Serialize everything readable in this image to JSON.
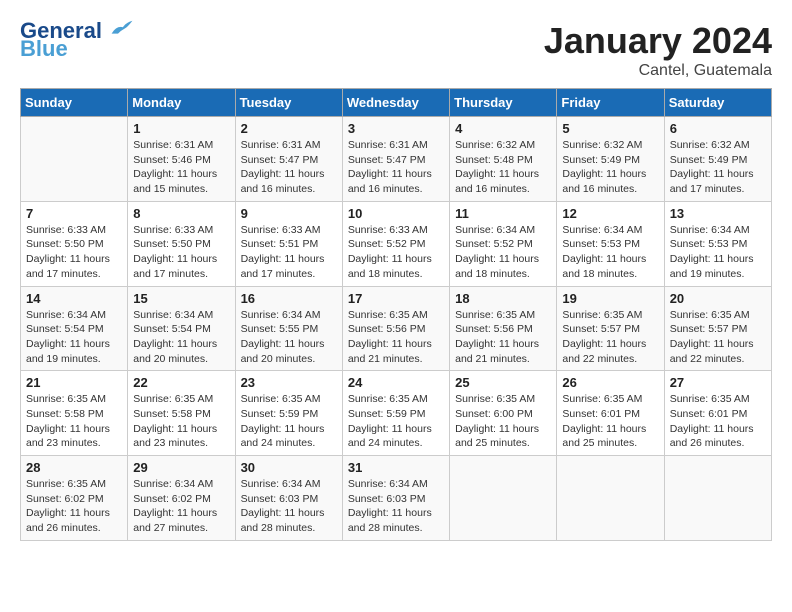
{
  "header": {
    "logo_line1": "General",
    "logo_line2": "Blue",
    "month_title": "January 2024",
    "subtitle": "Cantel, Guatemala"
  },
  "weekdays": [
    "Sunday",
    "Monday",
    "Tuesday",
    "Wednesday",
    "Thursday",
    "Friday",
    "Saturday"
  ],
  "weeks": [
    [
      {
        "day": "",
        "info": ""
      },
      {
        "day": "1",
        "info": "Sunrise: 6:31 AM\nSunset: 5:46 PM\nDaylight: 11 hours\nand 15 minutes."
      },
      {
        "day": "2",
        "info": "Sunrise: 6:31 AM\nSunset: 5:47 PM\nDaylight: 11 hours\nand 16 minutes."
      },
      {
        "day": "3",
        "info": "Sunrise: 6:31 AM\nSunset: 5:47 PM\nDaylight: 11 hours\nand 16 minutes."
      },
      {
        "day": "4",
        "info": "Sunrise: 6:32 AM\nSunset: 5:48 PM\nDaylight: 11 hours\nand 16 minutes."
      },
      {
        "day": "5",
        "info": "Sunrise: 6:32 AM\nSunset: 5:49 PM\nDaylight: 11 hours\nand 16 minutes."
      },
      {
        "day": "6",
        "info": "Sunrise: 6:32 AM\nSunset: 5:49 PM\nDaylight: 11 hours\nand 17 minutes."
      }
    ],
    [
      {
        "day": "7",
        "info": "Sunrise: 6:33 AM\nSunset: 5:50 PM\nDaylight: 11 hours\nand 17 minutes."
      },
      {
        "day": "8",
        "info": "Sunrise: 6:33 AM\nSunset: 5:50 PM\nDaylight: 11 hours\nand 17 minutes."
      },
      {
        "day": "9",
        "info": "Sunrise: 6:33 AM\nSunset: 5:51 PM\nDaylight: 11 hours\nand 17 minutes."
      },
      {
        "day": "10",
        "info": "Sunrise: 6:33 AM\nSunset: 5:52 PM\nDaylight: 11 hours\nand 18 minutes."
      },
      {
        "day": "11",
        "info": "Sunrise: 6:34 AM\nSunset: 5:52 PM\nDaylight: 11 hours\nand 18 minutes."
      },
      {
        "day": "12",
        "info": "Sunrise: 6:34 AM\nSunset: 5:53 PM\nDaylight: 11 hours\nand 18 minutes."
      },
      {
        "day": "13",
        "info": "Sunrise: 6:34 AM\nSunset: 5:53 PM\nDaylight: 11 hours\nand 19 minutes."
      }
    ],
    [
      {
        "day": "14",
        "info": "Sunrise: 6:34 AM\nSunset: 5:54 PM\nDaylight: 11 hours\nand 19 minutes."
      },
      {
        "day": "15",
        "info": "Sunrise: 6:34 AM\nSunset: 5:54 PM\nDaylight: 11 hours\nand 20 minutes."
      },
      {
        "day": "16",
        "info": "Sunrise: 6:34 AM\nSunset: 5:55 PM\nDaylight: 11 hours\nand 20 minutes."
      },
      {
        "day": "17",
        "info": "Sunrise: 6:35 AM\nSunset: 5:56 PM\nDaylight: 11 hours\nand 21 minutes."
      },
      {
        "day": "18",
        "info": "Sunrise: 6:35 AM\nSunset: 5:56 PM\nDaylight: 11 hours\nand 21 minutes."
      },
      {
        "day": "19",
        "info": "Sunrise: 6:35 AM\nSunset: 5:57 PM\nDaylight: 11 hours\nand 22 minutes."
      },
      {
        "day": "20",
        "info": "Sunrise: 6:35 AM\nSunset: 5:57 PM\nDaylight: 11 hours\nand 22 minutes."
      }
    ],
    [
      {
        "day": "21",
        "info": "Sunrise: 6:35 AM\nSunset: 5:58 PM\nDaylight: 11 hours\nand 23 minutes."
      },
      {
        "day": "22",
        "info": "Sunrise: 6:35 AM\nSunset: 5:58 PM\nDaylight: 11 hours\nand 23 minutes."
      },
      {
        "day": "23",
        "info": "Sunrise: 6:35 AM\nSunset: 5:59 PM\nDaylight: 11 hours\nand 24 minutes."
      },
      {
        "day": "24",
        "info": "Sunrise: 6:35 AM\nSunset: 5:59 PM\nDaylight: 11 hours\nand 24 minutes."
      },
      {
        "day": "25",
        "info": "Sunrise: 6:35 AM\nSunset: 6:00 PM\nDaylight: 11 hours\nand 25 minutes."
      },
      {
        "day": "26",
        "info": "Sunrise: 6:35 AM\nSunset: 6:01 PM\nDaylight: 11 hours\nand 25 minutes."
      },
      {
        "day": "27",
        "info": "Sunrise: 6:35 AM\nSunset: 6:01 PM\nDaylight: 11 hours\nand 26 minutes."
      }
    ],
    [
      {
        "day": "28",
        "info": "Sunrise: 6:35 AM\nSunset: 6:02 PM\nDaylight: 11 hours\nand 26 minutes."
      },
      {
        "day": "29",
        "info": "Sunrise: 6:34 AM\nSunset: 6:02 PM\nDaylight: 11 hours\nand 27 minutes."
      },
      {
        "day": "30",
        "info": "Sunrise: 6:34 AM\nSunset: 6:03 PM\nDaylight: 11 hours\nand 28 minutes."
      },
      {
        "day": "31",
        "info": "Sunrise: 6:34 AM\nSunset: 6:03 PM\nDaylight: 11 hours\nand 28 minutes."
      },
      {
        "day": "",
        "info": ""
      },
      {
        "day": "",
        "info": ""
      },
      {
        "day": "",
        "info": ""
      }
    ]
  ]
}
